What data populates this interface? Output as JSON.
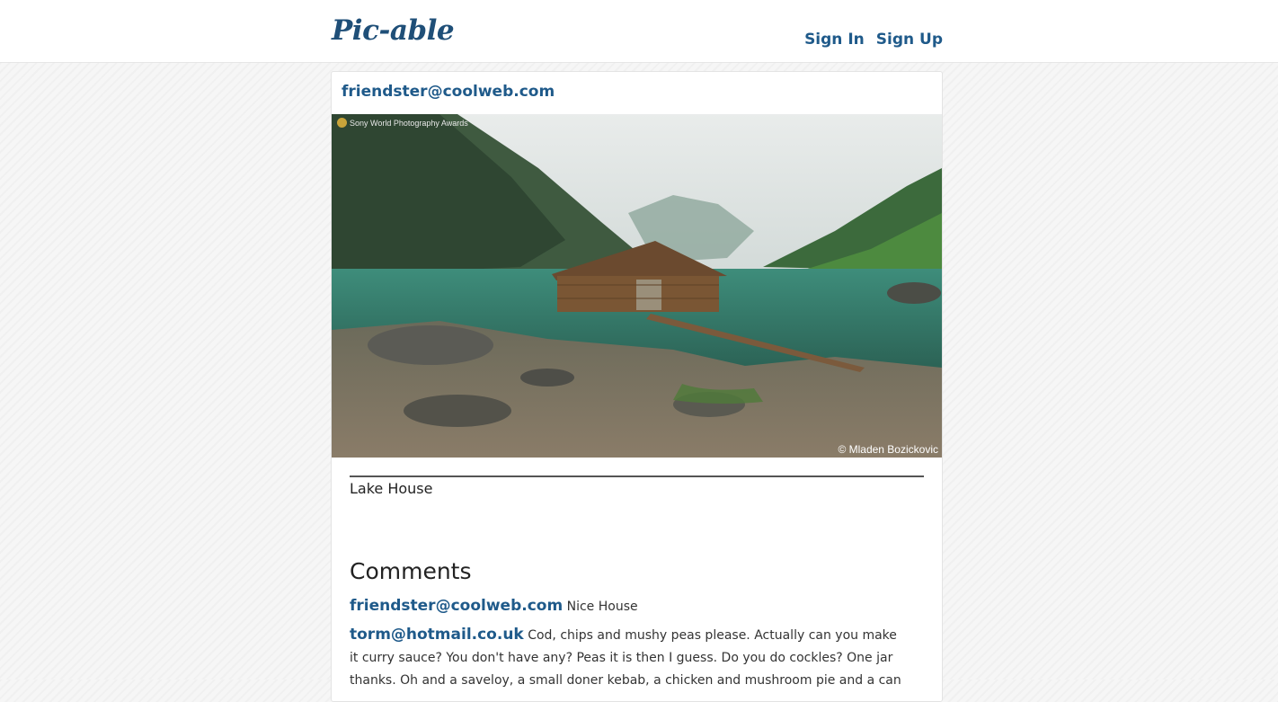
{
  "header": {
    "brand": "Pic-able",
    "links": [
      {
        "label": "Sign In"
      },
      {
        "label": "Sign Up"
      }
    ]
  },
  "post": {
    "author": "friendster@coolweb.com",
    "image": {
      "alt": "Lake House",
      "credit": "© Mladen Bozickovic",
      "watermark": "Sony World Photography Awards"
    },
    "caption": "Lake House"
  },
  "comments": {
    "heading": "Comments",
    "items": [
      {
        "author": "friendster@coolweb.com",
        "text": "Nice House"
      },
      {
        "author": "torm@hotmail.co.uk",
        "text": "Cod, chips and mushy peas please. Actually can you make it curry sauce? You don't have any? Peas it is then I guess. Do you do cockles? One jar thanks. Oh and a saveloy, a small doner kebab, a chicken and mushroom pie and a can"
      }
    ]
  },
  "colors": {
    "brand": "#1f4f78",
    "link": "#1f5a8a"
  }
}
